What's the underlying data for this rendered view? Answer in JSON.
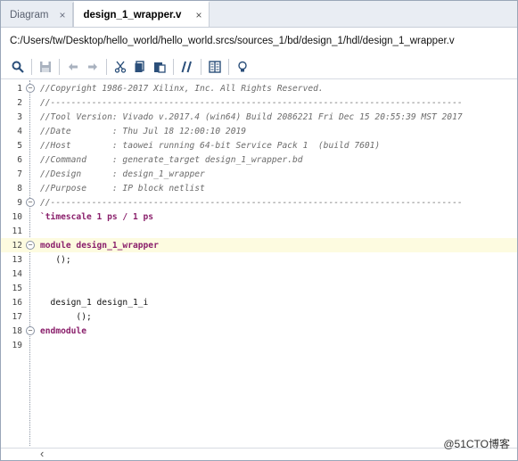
{
  "tabs": [
    {
      "label": "Diagram",
      "close": "×"
    },
    {
      "label": "design_1_wrapper.v",
      "close": "×"
    }
  ],
  "file_path": "C:/Users/tw/Desktop/hello_world/hello_world.srcs/sources_1/bd/design_1/hdl/design_1_wrapper.v",
  "toolbar": {
    "search": "search-icon",
    "save": "save-icon",
    "undo": "undo-icon",
    "redo": "redo-icon",
    "cut": "cut-icon",
    "copy": "copy-icon",
    "paste": "paste-icon",
    "comment": "comment-toggle-icon",
    "columns": "columns-icon",
    "lightbulb": "lightbulb-icon"
  },
  "code_lines": [
    {
      "n": "1",
      "text": "//Copyright 1986-2017 Xilinx, Inc. All Rights Reserved."
    },
    {
      "n": "2",
      "text": "//--------------------------------------------------------------------------------"
    },
    {
      "n": "3",
      "text": "//Tool Version: Vivado v.2017.4 (win64) Build 2086221 Fri Dec 15 20:55:39 MST 2017"
    },
    {
      "n": "4",
      "text": "//Date        : Thu Jul 18 12:00:10 2019"
    },
    {
      "n": "5",
      "text": "//Host        : taowei running 64-bit Service Pack 1  (build 7601)"
    },
    {
      "n": "6",
      "text": "//Command     : generate_target design_1_wrapper.bd"
    },
    {
      "n": "7",
      "text": "//Design      : design_1_wrapper"
    },
    {
      "n": "8",
      "text": "//Purpose     : IP block netlist"
    },
    {
      "n": "9",
      "text": "//--------------------------------------------------------------------------------"
    },
    {
      "n": "10",
      "text": "`timescale 1 ps / 1 ps"
    },
    {
      "n": "11",
      "text": ""
    },
    {
      "n": "12",
      "text": "module design_1_wrapper"
    },
    {
      "n": "13",
      "text": "   ();"
    },
    {
      "n": "14",
      "text": ""
    },
    {
      "n": "15",
      "text": ""
    },
    {
      "n": "16",
      "text": "  design_1 design_1_i"
    },
    {
      "n": "17",
      "text": "       ();"
    },
    {
      "n": "18",
      "text": "endmodule"
    },
    {
      "n": "19",
      "text": ""
    }
  ],
  "bottom": {
    "scroll_left": "‹",
    "watermark": "@51CTO博客"
  }
}
